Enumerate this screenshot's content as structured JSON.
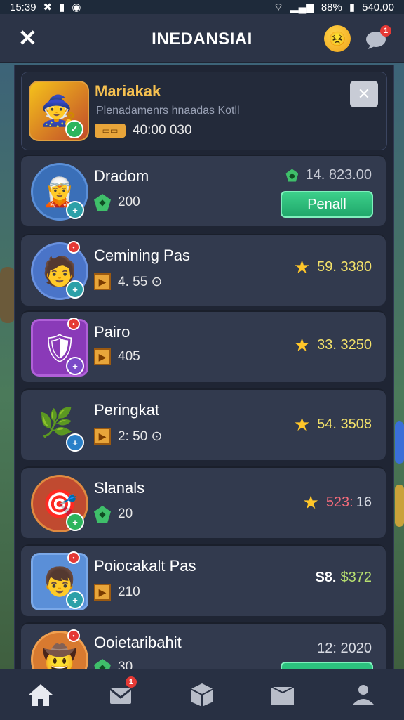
{
  "status_bar": {
    "time": "15:39",
    "left_icons": [
      "x-icon",
      "lock-icon",
      "circle-icon"
    ],
    "battery": "88%",
    "right_text": "540.00"
  },
  "header": {
    "title": "INEDANSIAI",
    "chat_badge": "1"
  },
  "featured": {
    "name": "Mariakak",
    "subtitle": "Plenadamenrs hnaadas Kotll",
    "amount": "40:00 030",
    "close_label": "✕"
  },
  "rows": [
    {
      "name": "Dradom",
      "sub_value": "200",
      "score": "14. 823.00",
      "action_label": "Penall",
      "sub_icon": "gem",
      "score_icon": "gem"
    },
    {
      "name": "Cemining Pas",
      "sub_value": "4. 55 ⊙",
      "score": "59. 3380",
      "sub_icon": "ticket",
      "score_icon": "star"
    },
    {
      "name": "Pairo",
      "sub_value": "405",
      "score": "33. 3250",
      "sub_icon": "ticket",
      "score_icon": "star"
    },
    {
      "name": "Peringkat",
      "sub_value": "2: 50 ⊙",
      "score": "54. 3508",
      "sub_icon": "ticket",
      "score_icon": "star"
    },
    {
      "name": "Slanals",
      "sub_value": "20",
      "score": "523:",
      "score_tail": "16",
      "sub_icon": "gem",
      "score_icon": "star"
    },
    {
      "name": "Poiocakalt Pas",
      "sub_value": "210",
      "score_prefix": "S8.",
      "score": "$372",
      "sub_icon": "ticket",
      "score_icon": "none"
    },
    {
      "name": "Ooietaribahit",
      "sub_value": "30",
      "score": "12: 2020",
      "sub_icon": "gem",
      "score_icon": "none"
    }
  ],
  "bottom_nav": {
    "items": [
      "home-icon",
      "mail-icon",
      "box-icon",
      "shop-icon",
      "profile-icon"
    ],
    "mail_badge": "1"
  },
  "colors": {
    "accent_green": "#2cc27e",
    "star": "#ffc629",
    "danger": "#e53935"
  }
}
